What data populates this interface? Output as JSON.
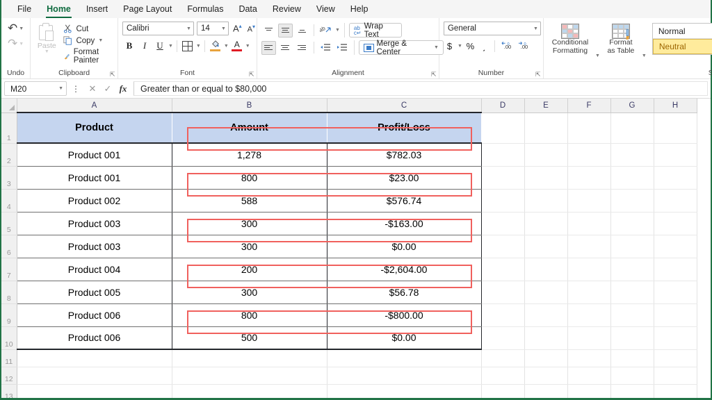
{
  "menubar": {
    "items": [
      {
        "label": "File",
        "active": false
      },
      {
        "label": "Home",
        "active": true
      },
      {
        "label": "Insert",
        "active": false
      },
      {
        "label": "Page Layout",
        "active": false
      },
      {
        "label": "Formulas",
        "active": false
      },
      {
        "label": "Data",
        "active": false
      },
      {
        "label": "Review",
        "active": false
      },
      {
        "label": "View",
        "active": false
      },
      {
        "label": "Help",
        "active": false
      }
    ]
  },
  "ribbon": {
    "undo": {
      "label": "Undo",
      "undo_icon": "undo-arrow-icon",
      "redo_icon": "redo-arrow-icon"
    },
    "clipboard": {
      "label": "Clipboard",
      "paste_label": "Paste",
      "cut_label": "Cut",
      "copy_label": "Copy",
      "format_painter_label": "Format Painter",
      "cut_icon": "scissors-icon",
      "copy_icon": "copy-icon",
      "format_painter_icon": "paintbrush-icon"
    },
    "font": {
      "label": "Font",
      "font_name": "Calibri",
      "font_size": "14",
      "grow_font": "A",
      "shrink_font": "A",
      "bold": "B",
      "italic": "I",
      "underline": "U",
      "borders_icon": "borders-grid-icon",
      "fill_color_icon": "fill-color-icon",
      "font_color_icon": "font-color-icon"
    },
    "alignment": {
      "label": "Alignment",
      "wrap_text_label": "Wrap Text",
      "merge_center_label": "Merge & Center",
      "orientation_icon": "text-orientation-icon",
      "indent_decrease_icon": "decrease-indent-icon",
      "indent_increase_icon": "increase-indent-icon"
    },
    "number": {
      "label": "Number",
      "format": "General",
      "currency": "$",
      "percent": "%",
      "comma": "͵",
      "increase_decimal_icon": "increase-decimal-icon",
      "decrease_decimal_icon": "decrease-decimal-icon"
    },
    "styles": {
      "label": "Sty",
      "conditional_formatting_label": "Conditional Formatting",
      "format_as_table_label": "Format as Table",
      "gallery": [
        {
          "label": "Normal",
          "selected": false
        },
        {
          "label": "Neutral",
          "selected": true
        }
      ]
    }
  },
  "formula_bar": {
    "name_box": "M20",
    "cancel_icon": "close-icon",
    "enter_icon": "check-icon",
    "fx_icon": "fx-icon",
    "formula": "Greater than or equal to $80,000"
  },
  "grid": {
    "columns": [
      "A",
      "B",
      "C",
      "D",
      "E",
      "F",
      "G",
      "H"
    ],
    "rows": [
      "1",
      "2",
      "3",
      "4",
      "5",
      "6",
      "7",
      "8",
      "9",
      "10",
      "11",
      "12",
      "13"
    ],
    "header_row": [
      "Product",
      "Amount",
      "Profit/Loss"
    ],
    "data": [
      {
        "row": "2",
        "product": "Product 001",
        "amount": "1,278",
        "profit_loss": "$782.03",
        "highlighted": true
      },
      {
        "row": "3",
        "product": "Product 001",
        "amount": "800",
        "profit_loss": "$23.00",
        "highlighted": false
      },
      {
        "row": "4",
        "product": "Product 002",
        "amount": "588",
        "profit_loss": "$576.74",
        "highlighted": true
      },
      {
        "row": "5",
        "product": "Product 003",
        "amount": "300",
        "profit_loss": "-$163.00",
        "highlighted": false
      },
      {
        "row": "6",
        "product": "Product 003",
        "amount": "300",
        "profit_loss": "$0.00",
        "highlighted": true
      },
      {
        "row": "7",
        "product": "Product 004",
        "amount": "200",
        "profit_loss": "-$2,604.00",
        "highlighted": false
      },
      {
        "row": "8",
        "product": "Product 005",
        "amount": "300",
        "profit_loss": "$56.78",
        "highlighted": true
      },
      {
        "row": "9",
        "product": "Product 006",
        "amount": "800",
        "profit_loss": "-$800.00",
        "highlighted": false
      },
      {
        "row": "10",
        "product": "Product 006",
        "amount": "500",
        "profit_loss": "$0.00",
        "highlighted": true
      }
    ]
  },
  "colors": {
    "accent_green": "#217346",
    "header_fill": "#c5d5ef",
    "highlight_border": "#f0605d",
    "neutral_style_bg": "#ffeb9c",
    "neutral_style_fg": "#9c6500"
  }
}
